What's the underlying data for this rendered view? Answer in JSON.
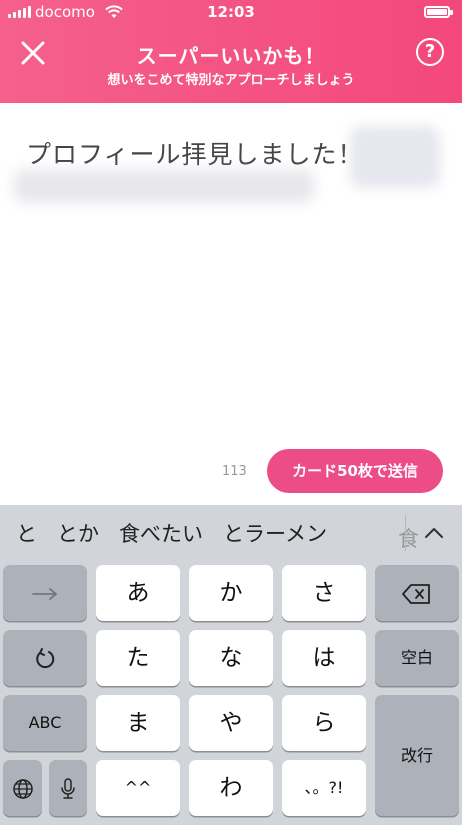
{
  "status": {
    "carrier": "docomo",
    "time": "12:03"
  },
  "header": {
    "title": "スーパーいいかも！",
    "subtitle": "想いをこめて特別なアプローチしましょう",
    "help_label": "?"
  },
  "message": {
    "text": "プロフィール拝見しました！"
  },
  "composer": {
    "char_count": "113",
    "send_label": "カード50枚で送信"
  },
  "keyboard": {
    "suggestions": [
      "と",
      "とか",
      "食べたい",
      "とラーメン"
    ],
    "suggestion_partial": "食",
    "keys": {
      "tenkey_a": "あ",
      "tenkey_ka": "か",
      "tenkey_sa": "さ",
      "tenkey_ta": "た",
      "tenkey_na": "な",
      "tenkey_ha": "は",
      "tenkey_ma": "ま",
      "tenkey_ya": "や",
      "tenkey_ra": "ら",
      "tenkey_kao": "^^",
      "tenkey_wa": "わ",
      "tenkey_punct": "、。?!",
      "abc": "ABC",
      "space": "空白",
      "return": "改行"
    }
  },
  "colors": {
    "accent": "#ec4d86",
    "header_start": "#f5608c",
    "header_end": "#f3487a",
    "keyboard_bg": "#d1d4d9"
  }
}
